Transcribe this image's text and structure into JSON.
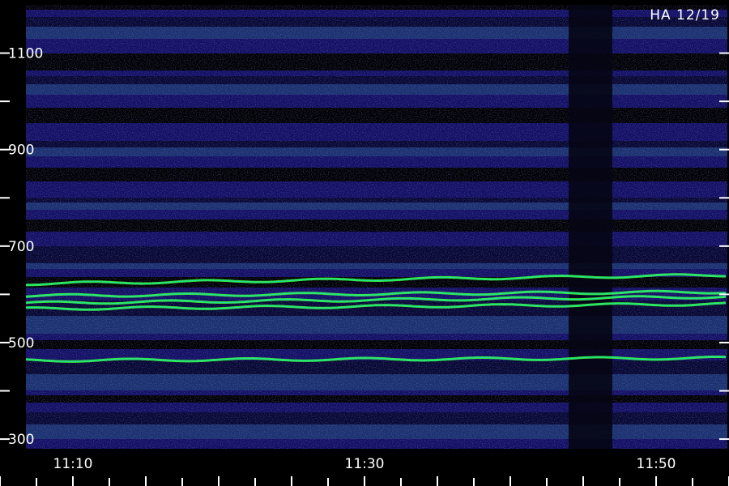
{
  "chart_data": {
    "type": "heatmap",
    "title": "HA 12/19",
    "xlabel": "",
    "ylabel": "",
    "x_ticks": [
      "11:10",
      "11:30",
      "11:50"
    ],
    "x_range": [
      "11:05",
      "11:55"
    ],
    "y_ticks": [
      "300",
      "500",
      "700",
      "900",
      "1100"
    ],
    "y_range": [
      280,
      1200
    ],
    "colormap": [
      "#000000",
      "#10106a",
      "#2a22d8",
      "#3a6cf0",
      "#20e0a0",
      "#38ff40",
      "#ff2020"
    ],
    "bright_traces": [
      {
        "start": 622,
        "end": 640
      },
      {
        "start": 597,
        "end": 605
      },
      {
        "start": 582,
        "end": 595
      },
      {
        "start": 570,
        "end": 580
      },
      {
        "start": 463,
        "end": 468
      }
    ],
    "dropout": {
      "start": "11:44",
      "end": "11:47"
    }
  }
}
